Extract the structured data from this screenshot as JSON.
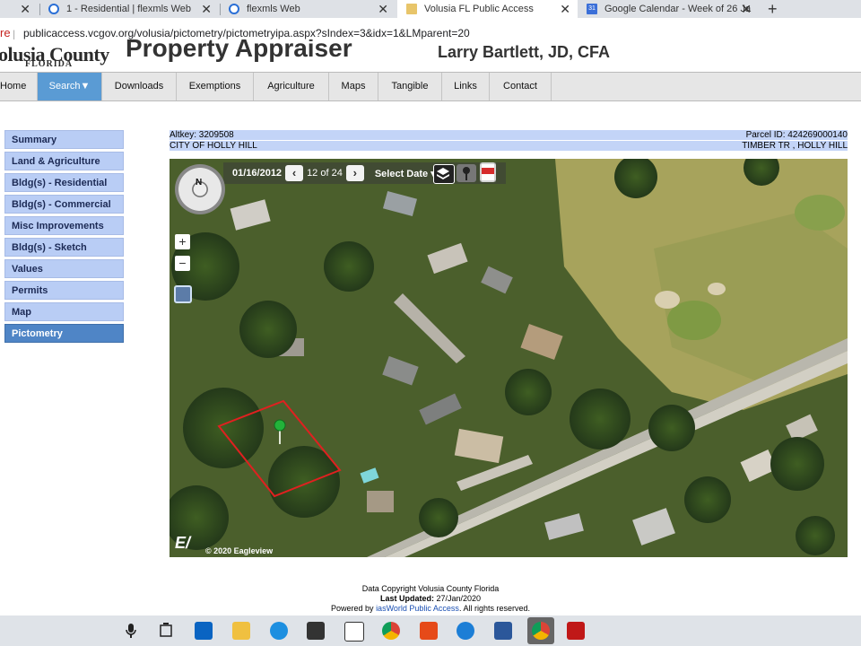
{
  "browser": {
    "tabs": [
      {
        "title": "1 - Residential | flexmls Web"
      },
      {
        "title": "flexmls Web"
      },
      {
        "title": "Volusia FL Public Access"
      },
      {
        "title": "Google Calendar - Week of 26 Ja"
      }
    ],
    "new_tab": "+",
    "close": "✕",
    "secure_label": "re",
    "url": "publicaccess.vcgov.org/volusia/pictometry/pictometryipa.aspx?sIndex=3&idx=1&LMparent=20",
    "calendar_badge": "31"
  },
  "header": {
    "logo_title": "olusia County",
    "logo_sub": "FLORIDA",
    "site_title": "Property Appraiser",
    "appraiser_name": "Larry Bartlett, JD, CFA"
  },
  "nav": {
    "items": [
      "Home",
      "Search▼",
      "Downloads",
      "Exemptions",
      "Agriculture",
      "Maps",
      "Tangible",
      "Links",
      "Contact"
    ],
    "active": "Search▼"
  },
  "sidebar": {
    "items": [
      "Summary",
      "Land & Agriculture",
      "Bldg(s) - Residential",
      "Bldg(s) - Commercial",
      "Misc Improvements",
      "Bldg(s) - Sketch",
      "Values",
      "Permits",
      "Map",
      "Pictometry"
    ],
    "active": "Pictometry"
  },
  "parcel": {
    "altkey": "Altkey: 3209508",
    "parcel_id": "Parcel ID: 424269000140",
    "city": "CITY OF HOLLY HILL",
    "address": "TIMBER TR , HOLLY HILL"
  },
  "map": {
    "compass_label": "N",
    "date": "01/16/2012",
    "prev": "‹",
    "page": "12 of 24",
    "next": "›",
    "select_date": "Select Date ▾",
    "zoom_in": "+",
    "zoom_out": "−",
    "logo": "E/",
    "copyright": "© 2020 Eagleview"
  },
  "footer": {
    "line1": "Data Copyright Volusia County Florida",
    "updated_label": "Last Updated:",
    "updated_value": "27/Jan/2020",
    "powered_prefix": "Powered by",
    "powered_link": "iasWorld Public Access",
    "powered_suffix": ". All rights reserved."
  },
  "colors": {
    "nav_active": "#5a9bd4",
    "sidebar_bg": "#b9cdf5",
    "sidebar_active": "#4f85c6",
    "parcel_bar": "#c3d4f7",
    "parcel_outline": "#e02020",
    "marker": "#22b33a"
  },
  "taskbar": {
    "icons": [
      "microphone-icon",
      "task-view-icon",
      "outlook-icon",
      "file-explorer-icon",
      "edge-icon",
      "store-icon",
      "mail-icon",
      "chrome-icon",
      "office-icon",
      "internet-explorer-icon",
      "word-icon",
      "chrome-profile-icon",
      "mcafee-icon"
    ]
  }
}
